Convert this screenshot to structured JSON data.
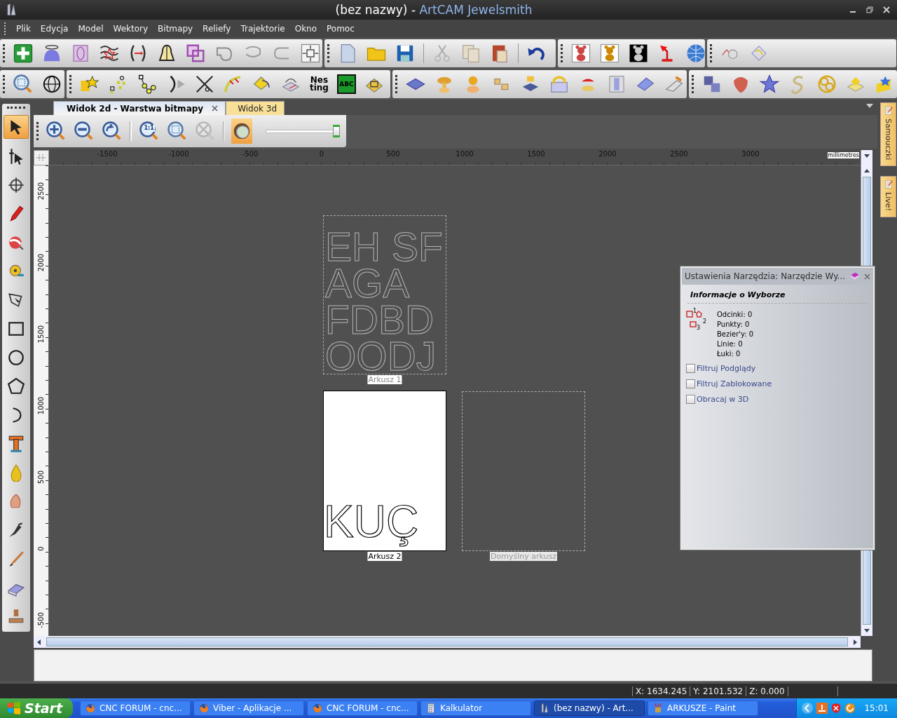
{
  "window": {
    "title": "(bez nazwy)",
    "separator": "-",
    "app_name": "ArtCAM Jewelsmith"
  },
  "menu": [
    "Plik",
    "Edycja",
    "Model",
    "Wektory",
    "Bitmapy",
    "Reliefy",
    "Trajektorie",
    "Okno",
    "Pomoc"
  ],
  "toolbar_labels": {
    "nesting": "Nes ting",
    "abc": "ABC"
  },
  "tool_palette": [
    {
      "kind": "select",
      "selected": true
    },
    {
      "kind": "node",
      "selected": false
    },
    {
      "kind": "move",
      "selected": false
    },
    {
      "kind": "pencil",
      "selected": false
    },
    {
      "kind": "paint",
      "selected": false
    },
    {
      "kind": "tape",
      "selected": false
    },
    {
      "kind": "lasso",
      "selected": false
    },
    {
      "kind": "rectangle",
      "selected": false
    },
    {
      "kind": "circle",
      "selected": false
    },
    {
      "kind": "pentagon",
      "selected": false
    },
    {
      "kind": "arc",
      "selected": false
    },
    {
      "kind": "text",
      "selected": false
    },
    {
      "kind": "drop",
      "selected": false
    },
    {
      "kind": "shell",
      "selected": false
    },
    {
      "kind": "pen",
      "selected": false
    },
    {
      "kind": "brush",
      "selected": false
    },
    {
      "kind": "eraser",
      "selected": false
    },
    {
      "kind": "stamp",
      "selected": false
    }
  ],
  "view": {
    "tabs": [
      {
        "label": "Widok 2d - Warstwa bitmapy",
        "selected": true,
        "closable": true
      },
      {
        "label": "Widok 3d",
        "selected": false,
        "closable": false
      }
    ],
    "tools": [
      {
        "kind": "zoom-in",
        "disabled": false,
        "selected": false
      },
      {
        "kind": "zoom-out",
        "disabled": false,
        "selected": false
      },
      {
        "kind": "zoom-back",
        "disabled": false,
        "selected": false
      },
      {
        "kind": "actual-size",
        "label": "1:1",
        "disabled": false,
        "selected": false
      },
      {
        "kind": "zoom-box",
        "disabled": false,
        "selected": false
      },
      {
        "kind": "zoom-fit",
        "disabled": true,
        "selected": false
      },
      {
        "kind": "shade",
        "disabled": false,
        "selected": true
      }
    ],
    "slider": {
      "level": 1
    },
    "ruler": {
      "unit": "millimetres",
      "x_labels": [
        "-1500",
        "-1000",
        "-500",
        "0",
        "500",
        "1000",
        "1500",
        "2000",
        "2500",
        "3000"
      ],
      "y_labels": [
        "2500",
        "2000",
        "1500",
        "1000",
        "500",
        "0",
        "-500"
      ]
    },
    "sheets": [
      {
        "label": "Arkusz 1",
        "kind": "outline",
        "vector_text": [
          "EH SF",
          "AGA",
          "FDBD",
          "OODJ"
        ]
      },
      {
        "label": "Arkusz 2",
        "kind": "filled",
        "vector_text": [
          "KUÇ"
        ]
      },
      {
        "label": "Domyślny arkusz",
        "kind": "empty"
      }
    ]
  },
  "tool_settings": {
    "title": "Ustawienia Narzędzia: Narzędzie Wy...",
    "section": "Informacje o Wyborze",
    "node_numbers": [
      "1",
      "2",
      "3"
    ],
    "stats": [
      "Odcinki: 0",
      "Punkty: 0",
      "Bezier'y: 0",
      "Linie: 0",
      "Łuki: 0"
    ],
    "options": [
      {
        "label": "Filtruj Podglądy",
        "checked": false
      },
      {
        "label": "Filtruj Zablokowane",
        "checked": false
      },
      {
        "label": "Obracaj w 3D",
        "checked": false
      }
    ]
  },
  "side_tabs": [
    "Samouczki",
    "Live!"
  ],
  "status_bar": {
    "x": "X: 1634.245",
    "y": "Y: 2101.532",
    "z": "Z: 0.000"
  },
  "taskbar": {
    "start": "Start",
    "tasks": [
      {
        "label": "CNC FORUM - cnc...",
        "kind": "browser",
        "selected": false
      },
      {
        "label": "Viber - Aplikacje ...",
        "kind": "browser",
        "selected": false
      },
      {
        "label": "CNC FORUM - cnc...",
        "kind": "browser",
        "selected": false
      },
      {
        "label": "Kalkulator",
        "kind": "calculator",
        "selected": false
      },
      {
        "label": "(bez nazwy) - Art...",
        "kind": "artcam",
        "selected": true
      },
      {
        "label": "ARKUSZE - Paint",
        "kind": "paint",
        "selected": false
      }
    ],
    "clock": "15:01"
  }
}
